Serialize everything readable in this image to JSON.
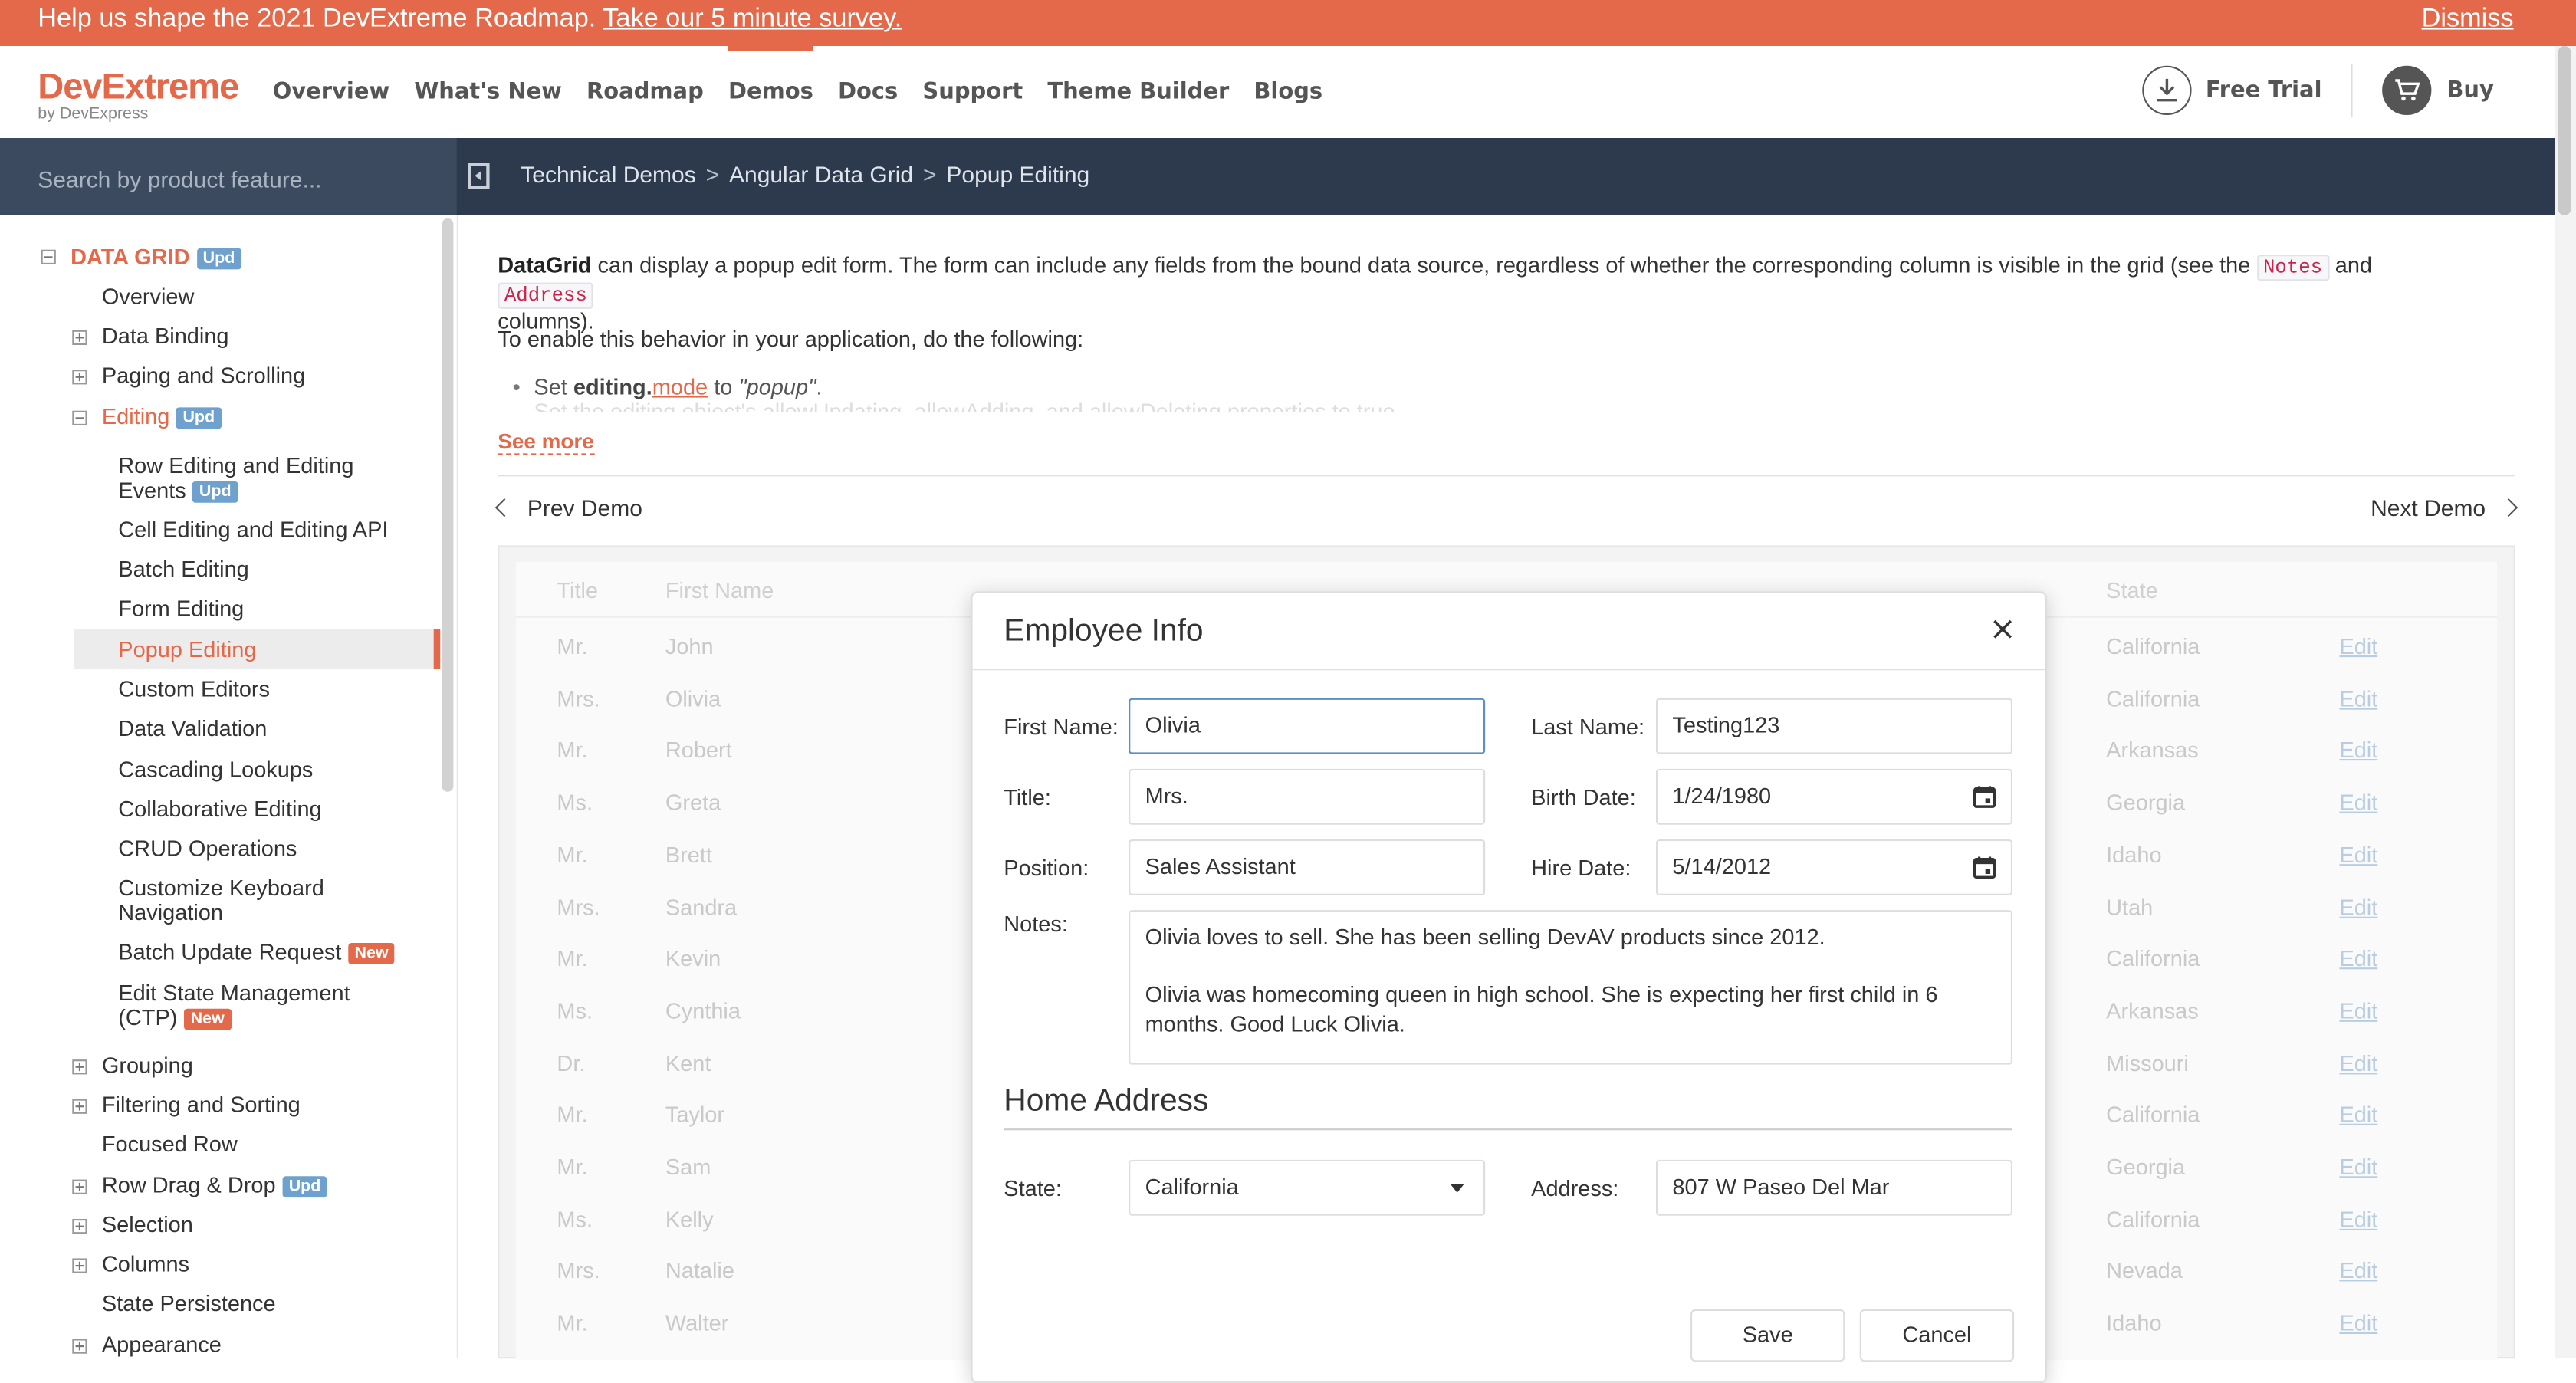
{
  "banner": {
    "message": "Help us shape the 2021 DevExtreme Roadmap.",
    "link": "Take our 5 minute survey.",
    "dismiss": "Dismiss"
  },
  "brand": {
    "name": "DevExtreme",
    "sub": "by DevExpress",
    "accent": "#e4694a"
  },
  "nav": [
    "Overview",
    "What's New",
    "Roadmap",
    "Demos",
    "Docs",
    "Support",
    "Theme Builder",
    "Blogs"
  ],
  "actions": {
    "trial": "Free Trial",
    "buy": "Buy"
  },
  "search": {
    "placeholder": "Search by product feature..."
  },
  "breadcrumb": [
    "Technical Demos",
    "Angular Data Grid",
    "Popup Editing"
  ],
  "sidebar": {
    "section": "DATA GRID",
    "section_badge": "Upd",
    "items": [
      {
        "label": "Overview"
      },
      {
        "label": "Data Binding"
      },
      {
        "label": "Paging and Scrolling"
      },
      {
        "label": "Editing",
        "badge": "Upd"
      },
      {
        "label": "Row Editing and Editing",
        "label2": "Events",
        "badge": "Upd"
      },
      {
        "label": "Cell Editing and Editing API"
      },
      {
        "label": "Batch Editing"
      },
      {
        "label": "Form Editing"
      },
      {
        "label": "Popup Editing"
      },
      {
        "label": "Custom Editors"
      },
      {
        "label": "Data Validation"
      },
      {
        "label": "Cascading Lookups"
      },
      {
        "label": "Collaborative Editing"
      },
      {
        "label": "CRUD Operations"
      },
      {
        "label": "Customize Keyboard",
        "label2": "Navigation"
      },
      {
        "label": "Batch Update Request",
        "badge": "New"
      },
      {
        "label": "Edit State Management",
        "label2": "(CTP)",
        "badge": "New"
      },
      {
        "label": "Grouping"
      },
      {
        "label": "Filtering and Sorting"
      },
      {
        "label": "Focused Row"
      },
      {
        "label": "Row Drag & Drop",
        "badge": "Upd"
      },
      {
        "label": "Selection"
      },
      {
        "label": "Columns"
      },
      {
        "label": "State Persistence"
      },
      {
        "label": "Appearance"
      }
    ]
  },
  "description": {
    "bold": "DataGrid",
    "text1": " can display a popup edit form. The form can include any fields from the bound data source, regardless of whether the corresponding column is visible in the grid (see the ",
    "code1": "Notes",
    "and": " and ",
    "code2": "Address",
    "text2": "columns).",
    "line2": "To enable this behavior in your application, do the following:",
    "bullet_set": "Set ",
    "bullet_editing": "editing",
    "bullet_dot": ".",
    "bullet_mode": "mode",
    "bullet_to": " to ",
    "bullet_value": "\"popup\"",
    "bullet_end": ".",
    "faded": "Set the editing object's allowUpdating, allowAdding, and allowDeleting properties to true.",
    "see_more": "See more"
  },
  "pager": {
    "prev": "Prev Demo",
    "next": "Next Demo"
  },
  "grid": {
    "headers": {
      "title": "Title",
      "first": "First Name",
      "state": "State"
    },
    "edit_label": "Edit",
    "rows": [
      {
        "title": "Mr.",
        "first": "John",
        "state": "California"
      },
      {
        "title": "Mrs.",
        "first": "Olivia",
        "state": "California"
      },
      {
        "title": "Mr.",
        "first": "Robert",
        "state": "Arkansas"
      },
      {
        "title": "Ms.",
        "first": "Greta",
        "state": "Georgia"
      },
      {
        "title": "Mr.",
        "first": "Brett",
        "state": "Idaho"
      },
      {
        "title": "Mrs.",
        "first": "Sandra",
        "state": "Utah"
      },
      {
        "title": "Mr.",
        "first": "Kevin",
        "state": "California"
      },
      {
        "title": "Ms.",
        "first": "Cynthia",
        "state": "Arkansas"
      },
      {
        "title": "Dr.",
        "first": "Kent",
        "state": "Missouri"
      },
      {
        "title": "Mr.",
        "first": "Taylor",
        "state": "California"
      },
      {
        "title": "Mr.",
        "first": "Sam",
        "state": "Georgia"
      },
      {
        "title": "Ms.",
        "first": "Kelly",
        "state": "California"
      },
      {
        "title": "Mrs.",
        "first": "Natalie",
        "state": "Nevada"
      },
      {
        "title": "Mr.",
        "first": "Walter",
        "state": "Idaho"
      }
    ]
  },
  "popup": {
    "title": "Employee Info",
    "fields": {
      "first_name_label": "First Name:",
      "first_name": "Olivia",
      "last_name_label": "Last Name:",
      "last_name": "Testing123",
      "title_label": "Title:",
      "title": "Mrs.",
      "birth_label": "Birth Date:",
      "birth": "1/24/1980",
      "position_label": "Position:",
      "position": "Sales Assistant",
      "hire_label": "Hire Date:",
      "hire": "5/14/2012",
      "notes_label": "Notes:",
      "notes_p1": "Olivia loves to sell. She has been selling DevAV products since 2012.",
      "notes_p2": "Olivia was homecoming queen in high school. She is expecting her first child in 6 months. Good Luck Olivia.",
      "state_label": "State:",
      "state": "California",
      "address_label": "Address:",
      "address": "807 W Paseo Del Mar"
    },
    "section": "Home Address",
    "save": "Save",
    "cancel": "Cancel"
  }
}
